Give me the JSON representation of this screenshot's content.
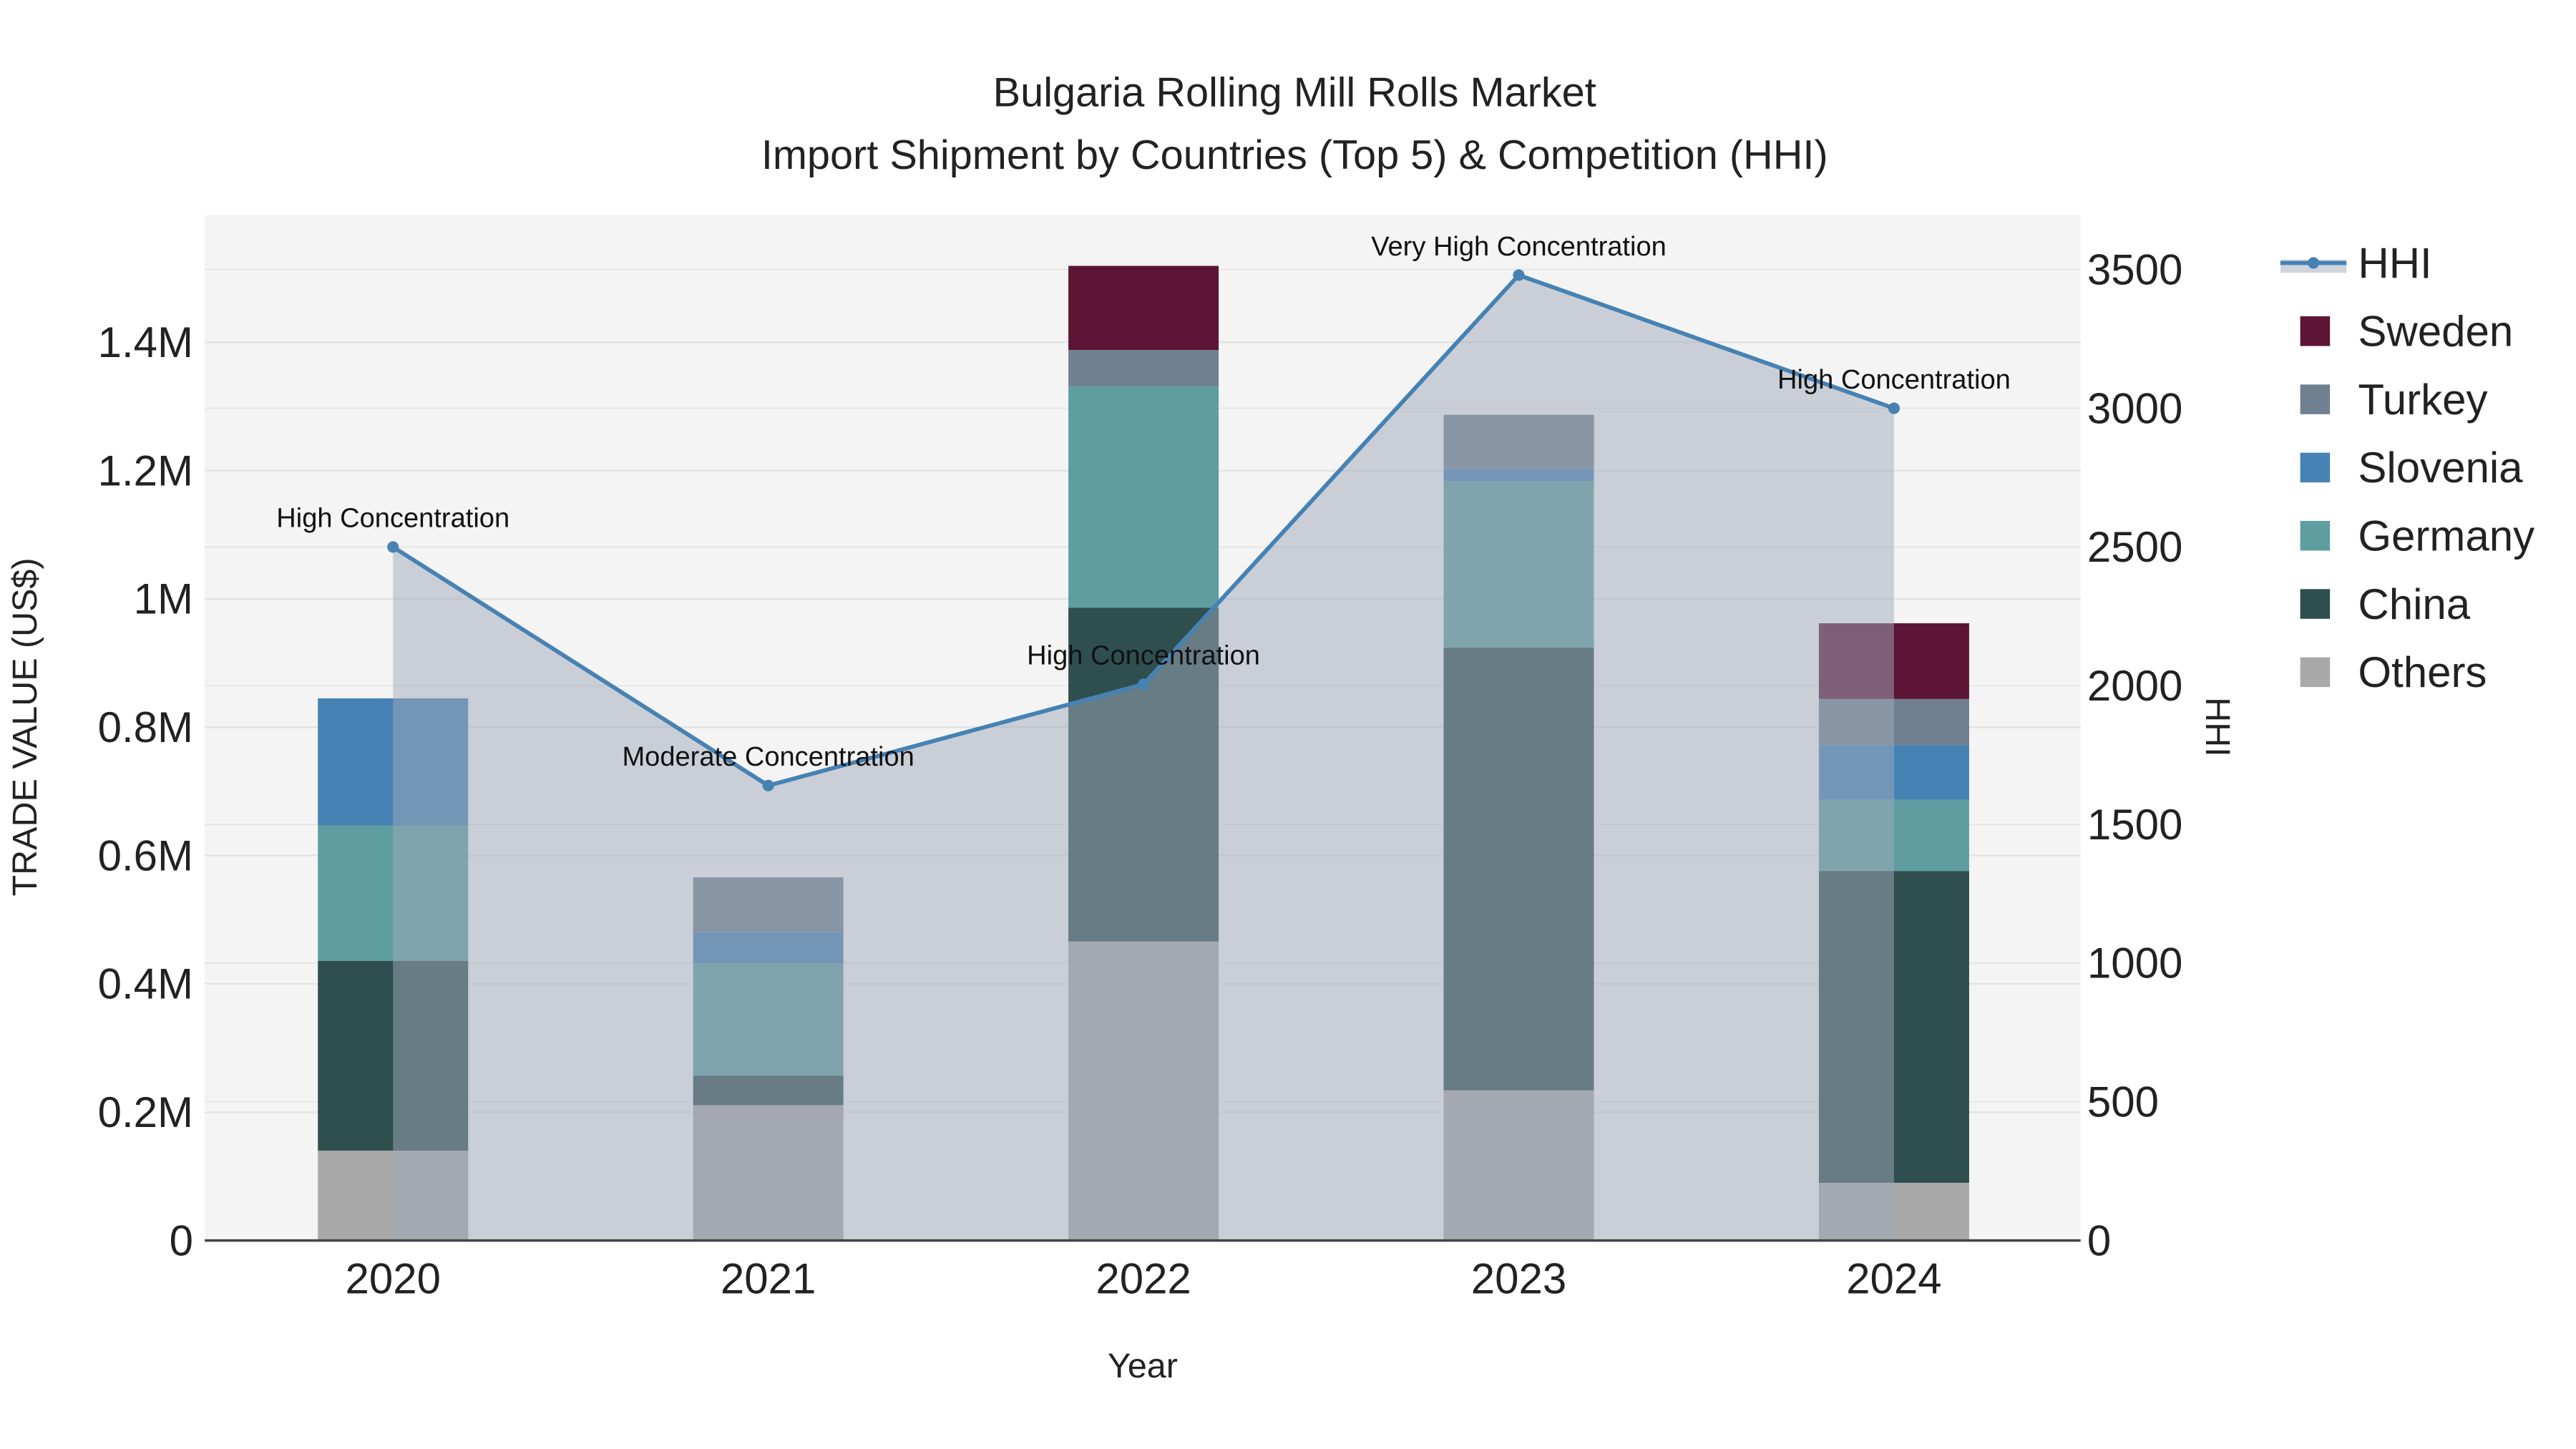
{
  "chart_data": {
    "type": "bar",
    "stacked": true,
    "title": "Bulgaria Rolling Mill Rolls Market",
    "subtitle": "Import Shipment by Countries (Top 5) & Competition (HHI)",
    "xlabel": "Year",
    "ylabel": "TRADE VALUE (US$)",
    "y2label": "HHI",
    "categories": [
      "2020",
      "2021",
      "2022",
      "2023",
      "2024"
    ],
    "ylim": [
      0,
      1600000
    ],
    "y_ticks": [
      0,
      200000,
      400000,
      600000,
      800000,
      1000000,
      1200000,
      1400000
    ],
    "y_tick_labels": [
      "0",
      "0.2M",
      "0.4M",
      "0.6M",
      "0.8M",
      "1M",
      "1.2M",
      "1.4M"
    ],
    "y2lim": [
      0,
      3700
    ],
    "y2_ticks": [
      0,
      500,
      1000,
      1500,
      2000,
      2500,
      3000,
      3500
    ],
    "y2_tick_labels": [
      "0",
      "500",
      "1000",
      "1500",
      "2000",
      "2500",
      "3000",
      "3500"
    ],
    "grid": true,
    "legend_position": "right",
    "series": [
      {
        "name": "Others",
        "color": "#a9a9a9",
        "values": [
          140000,
          211000,
          466000,
          234000,
          90000
        ]
      },
      {
        "name": "China",
        "color": "#2f4f4f",
        "values": [
          296000,
          46000,
          520000,
          690000,
          486000
        ]
      },
      {
        "name": "Germany",
        "color": "#5f9ea0",
        "values": [
          211000,
          175000,
          345000,
          260000,
          111000
        ]
      },
      {
        "name": "Slovenia",
        "color": "#4682b4",
        "values": [
          198000,
          49000,
          0,
          18000,
          85000
        ]
      },
      {
        "name": "Turkey",
        "color": "#708090",
        "values": [
          0,
          85000,
          57000,
          85000,
          72000
        ]
      },
      {
        "name": "Sweden",
        "color": "#5c1535",
        "values": [
          0,
          0,
          131000,
          0,
          118000
        ]
      }
    ],
    "hhi": {
      "name": "HHI",
      "color": "#4682b4",
      "values": [
        2500,
        1640,
        2005,
        3480,
        3000
      ],
      "annotations": [
        "High Concentration",
        "Moderate Concentration",
        "High Concentration",
        "Very High Concentration",
        "High Concentration"
      ]
    },
    "legend_order": [
      "HHI",
      "Sweden",
      "Turkey",
      "Slovenia",
      "Germany",
      "China",
      "Others"
    ]
  }
}
